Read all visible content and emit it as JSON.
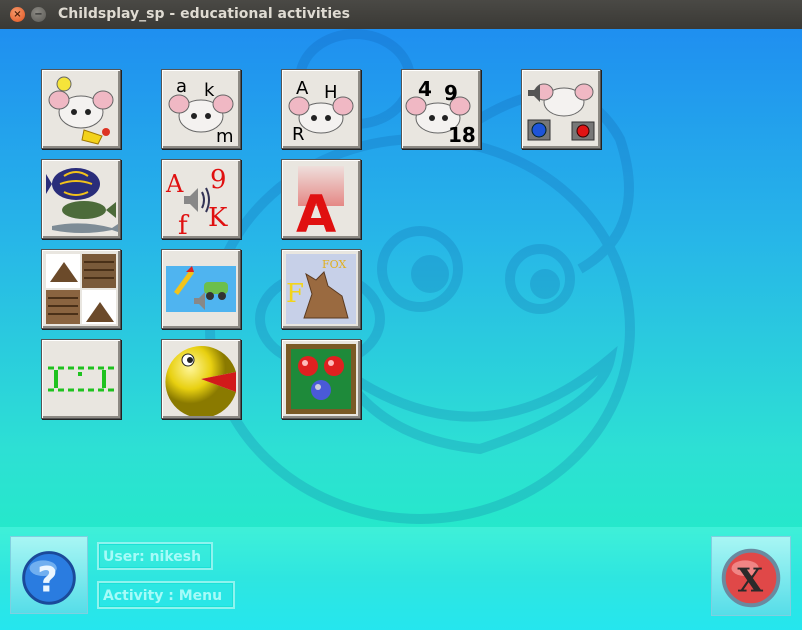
{
  "window": {
    "title": "Childsplay_sp - educational activities",
    "close_glyph": "×",
    "minimize_glyph": "−"
  },
  "tiles": [
    {
      "name": "activity-fruit-memory",
      "icon": "fruit-mouse-icon"
    },
    {
      "name": "activity-lowercase-letters",
      "icon": "lowercase-letters-icon",
      "letters": [
        "a",
        "k",
        "m"
      ]
    },
    {
      "name": "activity-uppercase-letters",
      "icon": "uppercase-letters-icon",
      "letters": [
        "A",
        "H",
        "R"
      ]
    },
    {
      "name": "activity-numbers",
      "icon": "numbers-icon",
      "letters": [
        "4",
        "9",
        "18"
      ]
    },
    {
      "name": "activity-sound-memory",
      "icon": "sound-memory-icon"
    },
    {
      "name": "activity-fish-tank",
      "icon": "fish-icon"
    },
    {
      "name": "activity-sound-letters",
      "icon": "sound-letters-icon",
      "letters": [
        "A",
        "9",
        "f",
        "K"
      ]
    },
    {
      "name": "activity-letter-flash",
      "icon": "red-letter-icon",
      "letters": [
        "A"
      ]
    },
    {
      "name": "activity-puzzle",
      "icon": "puzzle-icon"
    },
    {
      "name": "activity-sound-pictures",
      "icon": "sound-pictures-icon"
    },
    {
      "name": "activity-word-picture",
      "icon": "fox-icon",
      "letters": [
        "F",
        "FOX"
      ]
    },
    {
      "name": "activity-pong",
      "icon": "pong-icon"
    },
    {
      "name": "activity-pacman",
      "icon": "pacman-icon"
    },
    {
      "name": "activity-billiards",
      "icon": "billiard-balls-icon"
    }
  ],
  "bottom": {
    "user_label": "User: nikesh",
    "activity_label": "Activity : Menu",
    "help_icon": "question-icon",
    "quit_icon": "x-icon",
    "quit_glyph": "X",
    "help_glyph": "?"
  },
  "colors": {
    "sky_top": "#1f8ff0",
    "sky_bottom": "#1cf2bf",
    "info_text": "#a6fbf8"
  }
}
